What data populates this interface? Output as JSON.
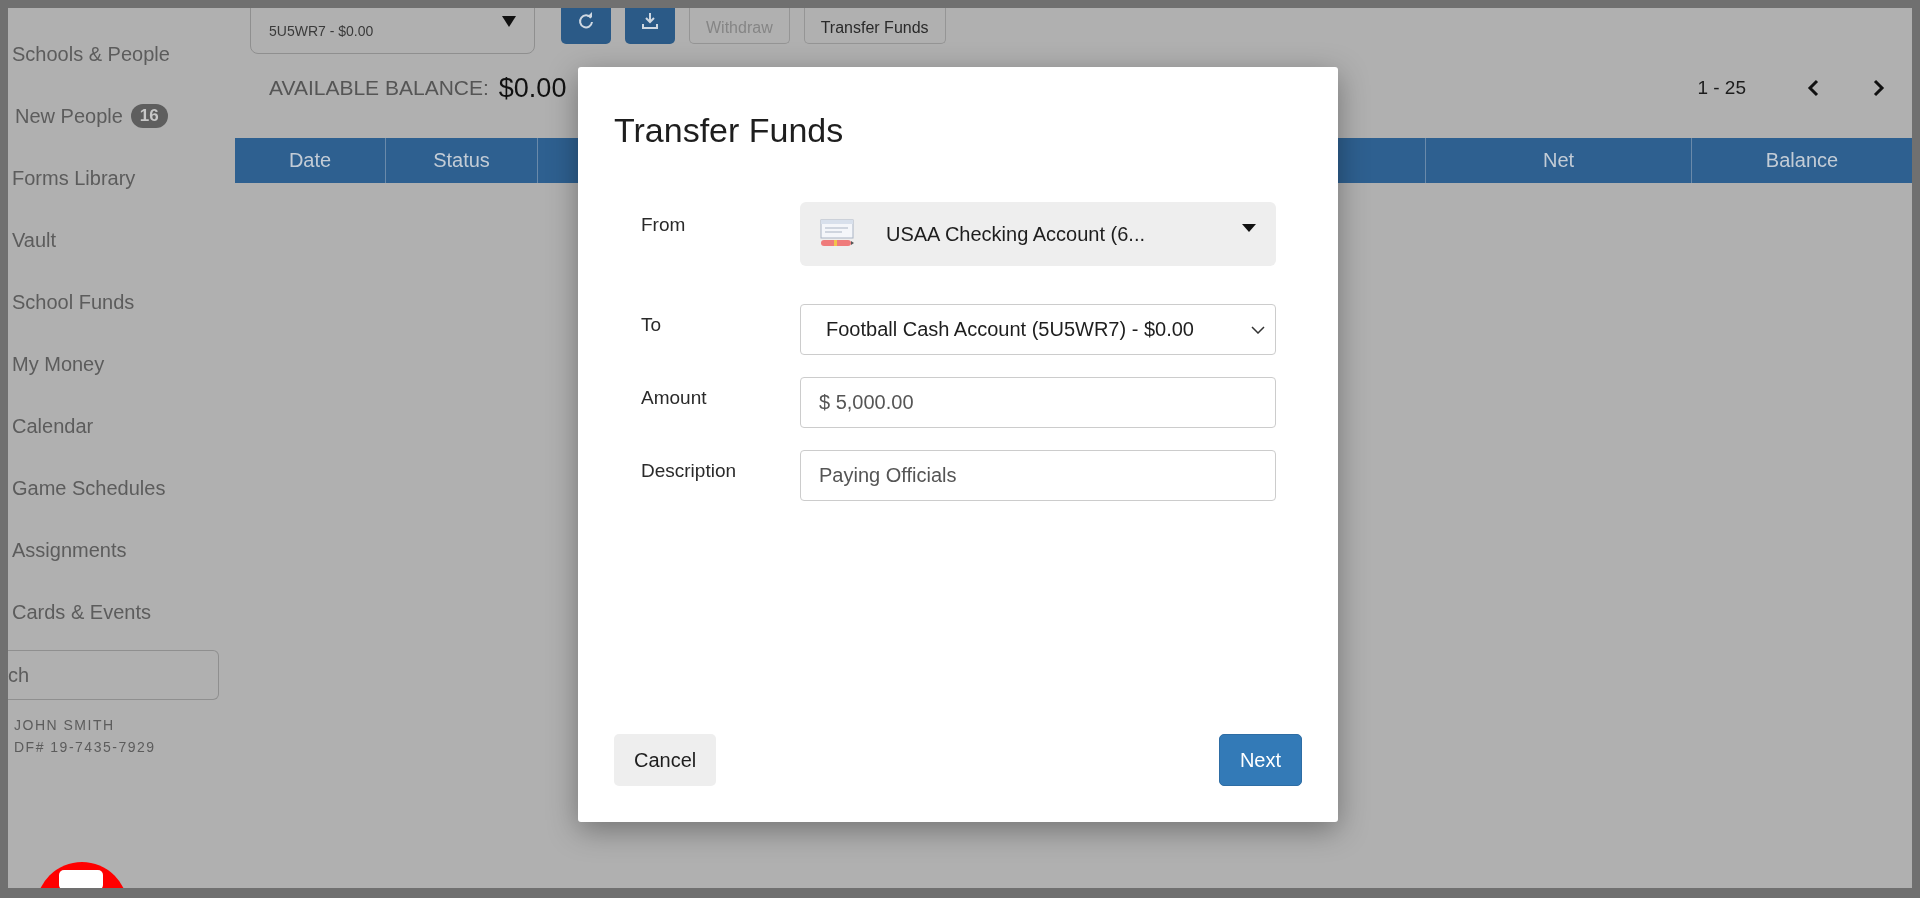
{
  "sidebar": {
    "items": [
      {
        "label": "Schools & People"
      },
      {
        "label": "New People",
        "badge": "16"
      },
      {
        "label": "Forms Library"
      },
      {
        "label": "Vault"
      },
      {
        "label": "School Funds"
      },
      {
        "label": "My Money"
      },
      {
        "label": "Calendar"
      },
      {
        "label": "Game Schedules"
      },
      {
        "label": "Assignments"
      },
      {
        "label": "Cards & Events"
      }
    ],
    "search": {
      "placeholder": "ch"
    },
    "user": {
      "name": "JOHN SMITH",
      "id": "DF# 19-7435-7929"
    }
  },
  "account_select": {
    "value": "5U5WR7 - $0.00"
  },
  "toolbar": [
    {
      "kind": "refresh",
      "disabled": false
    },
    {
      "kind": "download",
      "disabled": false
    },
    {
      "kind": "text",
      "label": "Withdraw",
      "disabled": true
    },
    {
      "kind": "text",
      "label": "Transfer Funds",
      "disabled": false
    }
  ],
  "balance": {
    "label": "AVAILABLE BALANCE:",
    "value": "$0.00"
  },
  "pagination": {
    "range": "1 - 25"
  },
  "table": {
    "columns": [
      {
        "label": "Date"
      },
      {
        "label": "Status"
      },
      {
        "label": "Net"
      },
      {
        "label": "Balance"
      }
    ]
  },
  "dialog": {
    "title": "Transfer Funds",
    "fields": [
      {
        "kind": "account_select",
        "label": "From",
        "value": "USAA Checking Account (6..."
      },
      {
        "kind": "select",
        "label": "To",
        "value": "Football Cash Account (5U5WR7) - $0.00"
      },
      {
        "kind": "text",
        "label": "Amount",
        "value": "$ 5,000.00"
      },
      {
        "kind": "text",
        "label": "Description",
        "value": "Paying Officials"
      }
    ],
    "buttons": [
      {
        "kind": "secondary",
        "label": "Cancel"
      },
      {
        "kind": "primary",
        "label": "Next"
      }
    ]
  }
}
